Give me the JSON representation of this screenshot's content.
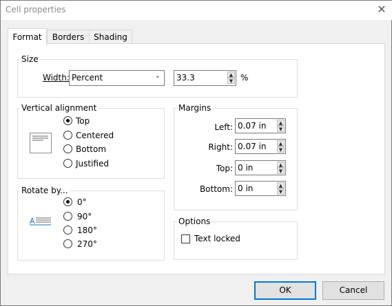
{
  "window": {
    "title": "Cell properties",
    "close_icon": "close-icon"
  },
  "tabs": [
    {
      "label": "Format",
      "active": true
    },
    {
      "label": "Borders",
      "active": false
    },
    {
      "label": "Shading",
      "active": false
    }
  ],
  "size": {
    "legend": "Size",
    "width_label": "Width:",
    "width_mode": "Percent",
    "width_value": "33.3",
    "unit": "%"
  },
  "vertical_alignment": {
    "legend": "Vertical alignment",
    "options": [
      {
        "label": "Top",
        "selected": true
      },
      {
        "label": "Centered",
        "selected": false
      },
      {
        "label": "Bottom",
        "selected": false
      },
      {
        "label": "Justified",
        "selected": false
      }
    ]
  },
  "rotate": {
    "legend": "Rotate by...",
    "options": [
      {
        "label": "0°",
        "selected": true
      },
      {
        "label": "90°",
        "selected": false
      },
      {
        "label": "180°",
        "selected": false
      },
      {
        "label": "270°",
        "selected": false
      }
    ]
  },
  "margins": {
    "legend": "Margins",
    "left_label": "Left:",
    "left_value": "0.07 in",
    "right_label": "Right:",
    "right_value": "0.07 in",
    "top_label": "Top:",
    "top_value": "0 in",
    "bottom_label": "Bottom:",
    "bottom_value": "0 in"
  },
  "options": {
    "legend": "Options",
    "text_locked_label": "Text locked",
    "text_locked_checked": false
  },
  "buttons": {
    "ok": "OK",
    "cancel": "Cancel"
  },
  "colors": {
    "accent": "#0078d7",
    "dialog_bg": "#f0f0f0",
    "rotate_icon_text": "#1e6fc4"
  }
}
